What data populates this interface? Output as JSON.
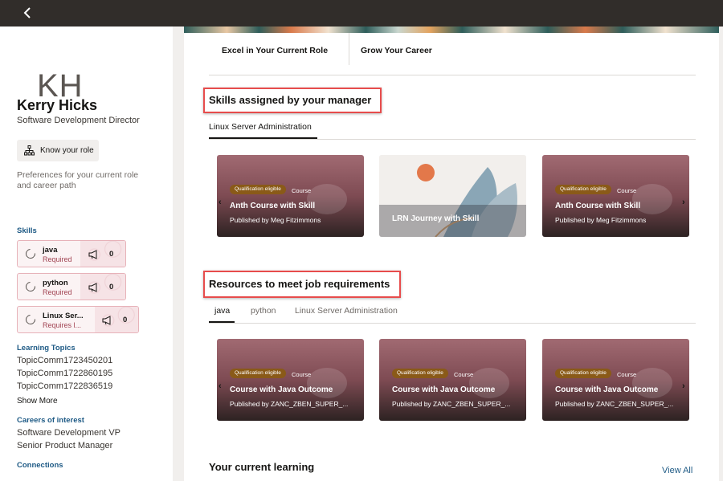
{
  "profile": {
    "initials": "KH",
    "name": "Kerry Hicks",
    "title": "Software Development Director",
    "know_role_label": "Know your role",
    "preferences_text": "Preferences for your current role and career path"
  },
  "skills": {
    "heading": "Skills",
    "items": [
      {
        "name": "java",
        "status": "Required",
        "count": "0"
      },
      {
        "name": "python",
        "status": "Required",
        "count": "0"
      },
      {
        "name": "Linux Ser...",
        "status": "Requires l...",
        "count": "0"
      }
    ]
  },
  "learning_topics": {
    "heading": "Learning Topics",
    "items": [
      "TopicComm1723450201",
      "TopicComm1722860195",
      "TopicComm1722836519"
    ],
    "show_more": "Show More"
  },
  "careers": {
    "heading": "Careers of interest",
    "items": [
      "Software Development VP",
      "Senior Product Manager"
    ]
  },
  "connections": {
    "heading": "Connections"
  },
  "top_tabs": [
    "Excel in Your Current Role",
    "Grow Your Career"
  ],
  "manager_skills": {
    "title": "Skills assigned by your manager",
    "tab": "Linux Server Administration",
    "cards": [
      {
        "badge": "Qualification eligible",
        "type": "Course",
        "title": "Anth Course with Skill",
        "publisher": "Published by Meg Fitzimmons"
      },
      {
        "title": "LRN Journey with Skill"
      },
      {
        "badge": "Qualification eligible",
        "type": "Course",
        "title": "Anth Course with Skill",
        "publisher": "Published by Meg Fitzimmons"
      }
    ]
  },
  "resources": {
    "title": "Resources to meet job requirements",
    "tabs": [
      "java",
      "python",
      "Linux Server Administration"
    ],
    "cards": [
      {
        "badge": "Qualification eligible",
        "type": "Course",
        "title": "Course with Java Outcome",
        "publisher": "Published by ZANC_ZBEN_SUPER_..."
      },
      {
        "badge": "Qualification eligible",
        "type": "Course",
        "title": "Course with Java Outcome",
        "publisher": "Published by ZANC_ZBEN_SUPER_..."
      },
      {
        "badge": "Qualification eligible",
        "type": "Course",
        "title": "Course with Java Outcome",
        "publisher": "Published by ZANC_ZBEN_SUPER_..."
      }
    ]
  },
  "current_learning": {
    "title": "Your current learning",
    "view_all": "View All"
  },
  "icons": {
    "back": "chevron-left-icon",
    "org": "org-chart-icon",
    "progress": "progress-ring-icon",
    "endorse": "megaphone-icon",
    "prev": "chevron-left-icon",
    "next": "chevron-right-icon"
  },
  "colors": {
    "header": "#312d2a",
    "link": "#1e5a85",
    "required": "#a14352",
    "badge": "#8a5a18",
    "highlight": "#e74c4c"
  }
}
